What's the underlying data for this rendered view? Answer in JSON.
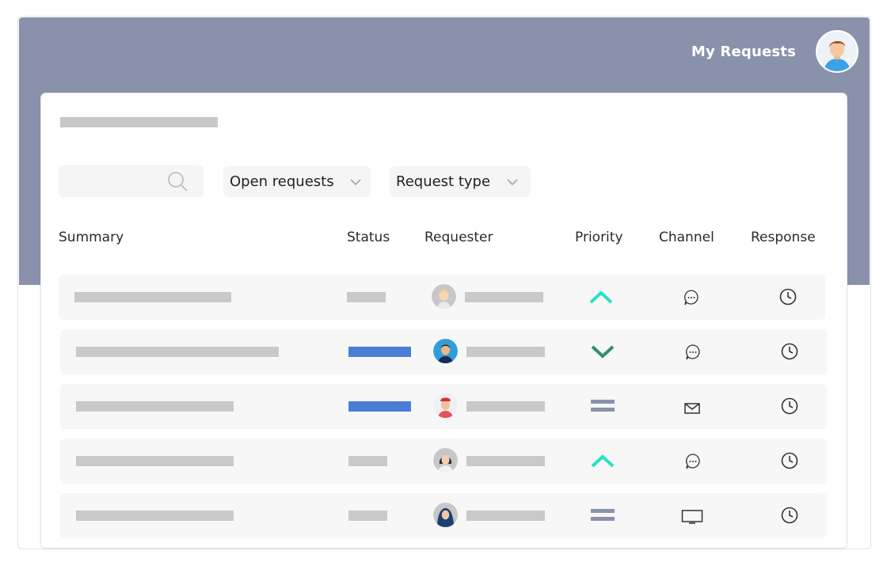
{
  "header": {
    "title": "My Requests",
    "avatar": "user-avatar-icon"
  },
  "filters": {
    "search_icon": "search-icon",
    "dropdowns": [
      {
        "label": "Open requests",
        "icon": "chevron-down-icon"
      },
      {
        "label": "Request type",
        "icon": "chevron-down-icon"
      }
    ]
  },
  "table": {
    "columns": [
      "Summary",
      "Status",
      "Requester",
      "Priority",
      "Channel",
      "Response"
    ],
    "rows": [
      {
        "status": "neutral",
        "requester_avatar": "avatar-blonde",
        "priority": "high",
        "channel": "chat-icon",
        "response": "clock-icon"
      },
      {
        "status": "blue",
        "requester_avatar": "avatar-man-blue",
        "priority": "low",
        "channel": "chat-icon",
        "response": "clock-icon"
      },
      {
        "status": "blue",
        "requester_avatar": "avatar-man-red",
        "priority": "medium",
        "channel": "email-icon",
        "response": "clock-icon"
      },
      {
        "status": "neutral",
        "requester_avatar": "avatar-woman-dark",
        "priority": "high",
        "channel": "chat-icon",
        "response": "clock-icon"
      },
      {
        "status": "neutral",
        "requester_avatar": "avatar-woman-hijab",
        "priority": "medium",
        "channel": "monitor-icon",
        "response": "clock-icon"
      }
    ]
  },
  "colors": {
    "header": "#8a91ab",
    "status_blue": "#4a7ed6",
    "priority_high": "#27e2c4",
    "priority_low": "#2e8f74",
    "priority_medium": "#8a91ab"
  }
}
